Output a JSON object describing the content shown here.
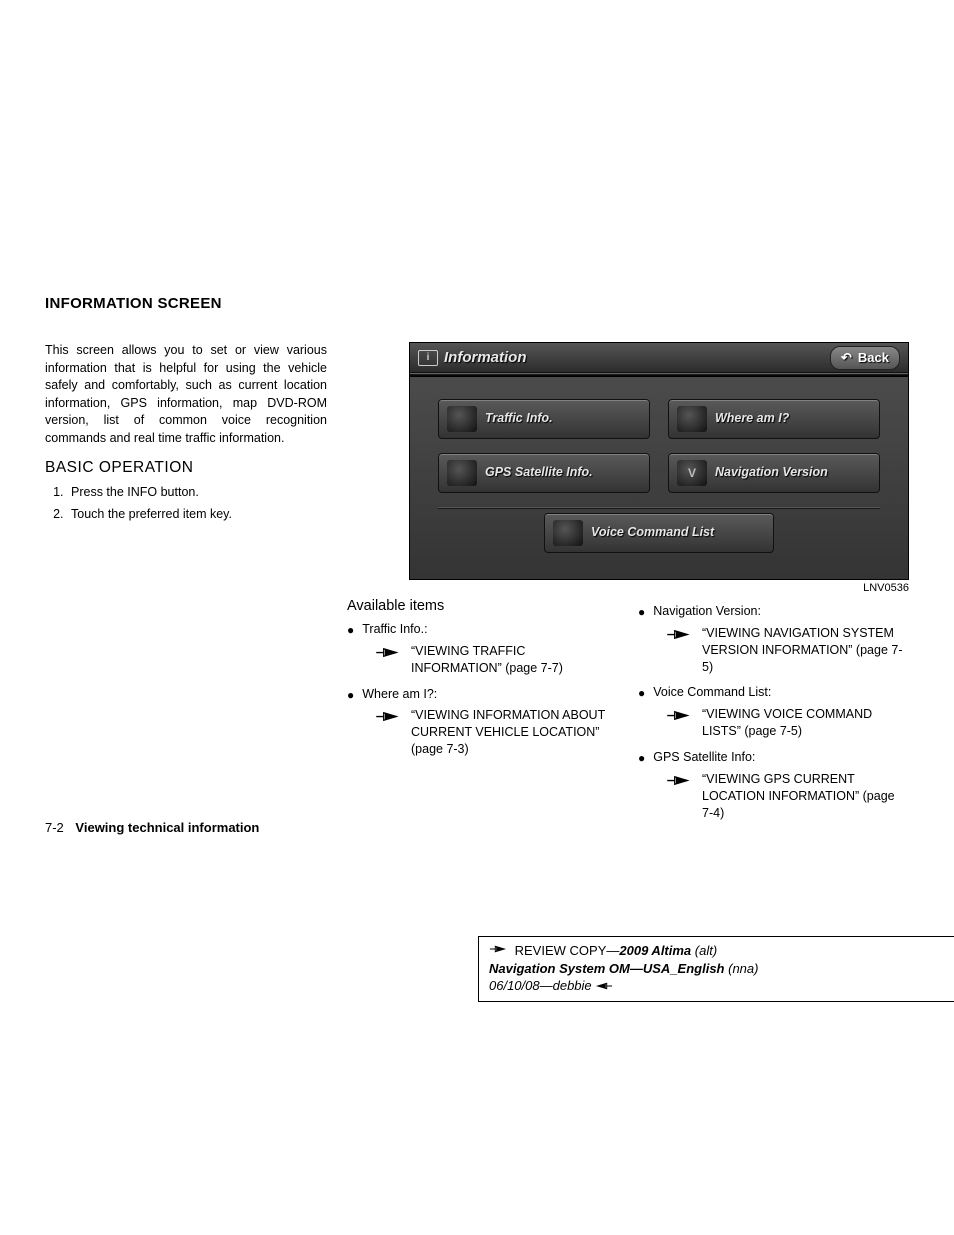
{
  "heading": "INFORMATION SCREEN",
  "intro": "This screen allows you to set or view various information that is helpful for using the vehicle safely and comfortably, such as current location information, GPS information, map DVD-ROM version, list of common voice recognition commands and real time traffic information.",
  "subheading": "BASIC OPERATION",
  "steps": [
    "Press the INFO button.",
    "Touch the preferred item key."
  ],
  "nav": {
    "title": "Information",
    "back": "Back",
    "buttons": {
      "traffic": "Traffic Info.",
      "where": "Where am I?",
      "gps": "GPS Satellite Info.",
      "navver": "Navigation Version",
      "voice": "Voice Command List"
    },
    "figcode": "LNV0536"
  },
  "available": {
    "heading": "Available items",
    "left": [
      {
        "label": "Traffic Info.:",
        "ref": "“VIEWING TRAFFIC INFORMATION” (page 7-7)"
      },
      {
        "label": "Where am I?:",
        "ref": "“VIEWING INFORMATION ABOUT CURRENT VEHICLE LOCATION” (page 7-3)"
      }
    ],
    "right": [
      {
        "label": "Navigation Version:",
        "ref": "“VIEWING NAVIGATION SYSTEM VERSION INFORMATION” (page 7-5)"
      },
      {
        "label": "Voice Command List:",
        "ref": "“VIEWING VOICE COMMAND LISTS” (page 7-5)"
      },
      {
        "label": "GPS Satellite Info:",
        "ref": "“VIEWING GPS CURRENT LOCATION INFORMATION” (page 7-4)"
      }
    ]
  },
  "footer": {
    "page": "7-2",
    "section": "Viewing technical information"
  },
  "review": {
    "l1a": "REVIEW COPY—",
    "l1b": "2009 Altima",
    "l1c": " (alt)",
    "l2a": "Navigation System OM—USA_English",
    "l2b": " (nna)",
    "l3a": "06/10/08—debbie "
  }
}
